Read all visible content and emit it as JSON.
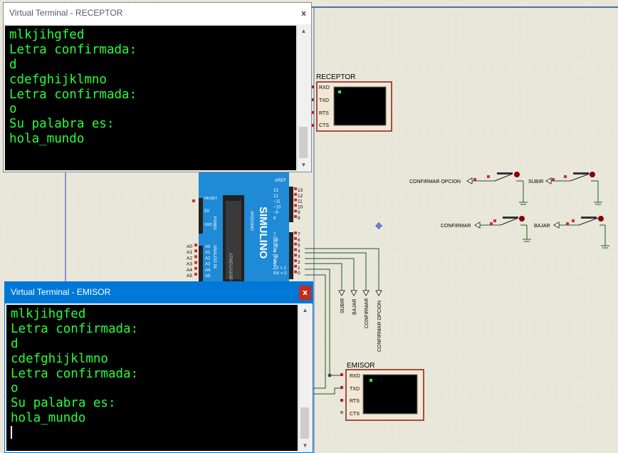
{
  "receptor_window": {
    "title": "Virtual Terminal - RECEPTOR",
    "close_glyph": "x",
    "lines": [
      "mlkjihgfed",
      "Letra confirmada:",
      "d",
      "cdefghijklmno",
      "Letra confirmada:",
      "o",
      "Su palabra es:",
      "hola_mundo"
    ]
  },
  "emisor_window": {
    "title": "Virtual Terminal - EMISOR",
    "close_glyph": "x",
    "lines": [
      "mlkjihgfed",
      "Letra confirmada:",
      "d",
      "cdefghijklmno",
      "Letra confirmada:",
      "o",
      "Su palabra es:",
      "hola_mundo"
    ]
  },
  "scrollbar_arrows": {
    "up": "▲",
    "down": "▼"
  },
  "schematic": {
    "receptor": {
      "label": "RECEPTOR",
      "pins": [
        "RXD",
        "TXD",
        "RTS",
        "CTS"
      ]
    },
    "emisor": {
      "label": "EMISOR",
      "pins": [
        "RXD",
        "TXD",
        "RTS",
        "CTS"
      ]
    },
    "buttons": {
      "confirmar_opcion": "CONFIRMAR OPCION",
      "subir": "SUBIR",
      "confirmar": "CONFIRMAR",
      "bajar": "BAJAR"
    },
    "arduino": {
      "brand": "SIMULINO",
      "sub": "ARDUINO",
      "aref": "AREF",
      "reset": "RESET",
      "v5": "5V",
      "gnd": "GND",
      "power": "POWER",
      "analog_in": "ANALOG IN",
      "digital_pwm": "DIGITAL (PWM~)",
      "chip": "ATMEGA328P",
      "analog_pins": [
        "A0",
        "A1",
        "A2",
        "A3",
        "A4",
        "A5"
      ],
      "analog_pin_labels": [
        "A0",
        "A1",
        "A2",
        "A3",
        "A4",
        "A5"
      ],
      "pin_numbers_top": [
        "13",
        "12",
        "11",
        "10",
        "9",
        "8"
      ],
      "pin_labels_top": [
        "13",
        "12",
        "~11",
        "~10",
        "~9",
        "8"
      ],
      "pin_numbers_bottom": [
        "7",
        "6",
        "5",
        "4",
        "3",
        "2",
        "1",
        "0"
      ],
      "pin_labels_bottom": [
        "7",
        "~6",
        "~5",
        "4",
        "~3",
        "2",
        "TX > 1",
        "RX < 0"
      ]
    },
    "terminal_labels": [
      "SUBIR",
      "BAJAR",
      "CONFIRMAR",
      "CONFIRMAR OPCION"
    ]
  },
  "colors": {
    "terminal_text": "#26ff3a",
    "wire": "#1f5c1f",
    "arduino_board": "#1f8ad6",
    "active_title": "#0078d7"
  }
}
